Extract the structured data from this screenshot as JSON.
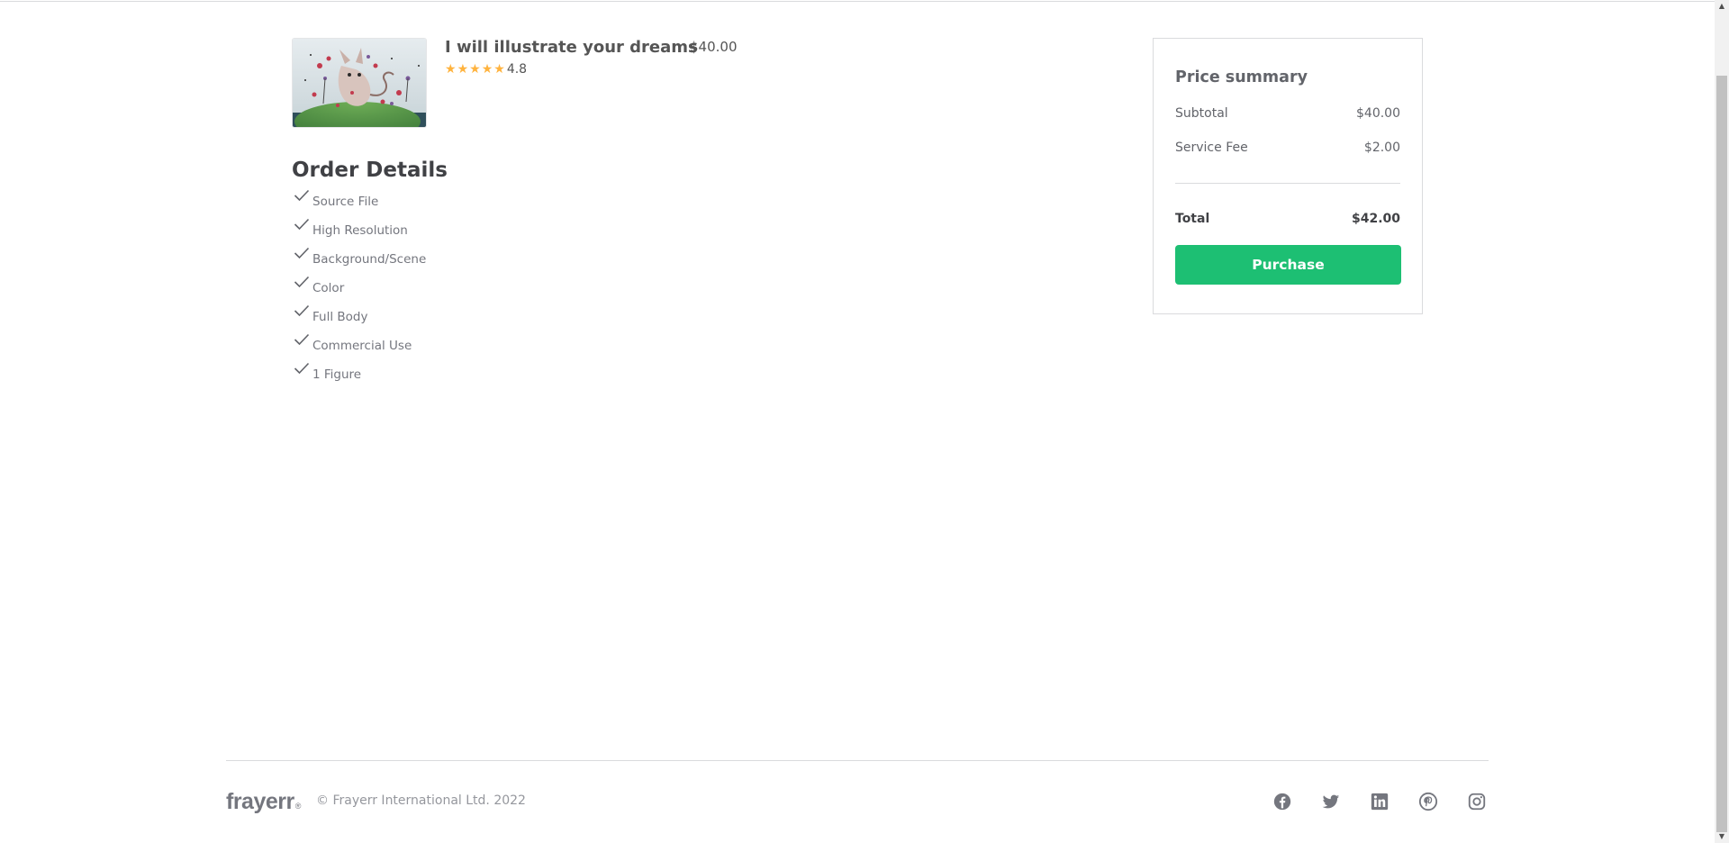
{
  "gig": {
    "image_alt": "Whimsical illustration of a cat in a fantasy garden",
    "title": "I will illustrate your dreams",
    "price": "$40.00",
    "rating": "4.8",
    "stars_filled": 5
  },
  "order_details": {
    "title": "Order Details",
    "features": [
      "Source File",
      "High Resolution",
      "Background/Scene",
      "Color",
      "Full Body",
      "Commercial Use",
      "1 Figure"
    ]
  },
  "summary": {
    "title": "Price summary",
    "subtotal_label": "Subtotal",
    "subtotal_value": "$40.00",
    "fee_label": "Service Fee",
    "fee_value": "$2.00",
    "total_label": "Total",
    "total_value": "$42.00",
    "purchase_label": "Purchase"
  },
  "footer": {
    "logo": "frayerr",
    "logo_mark": "®",
    "copyright": "© Frayerr International Ltd. 2022",
    "social_icons": [
      "facebook-icon",
      "twitter-icon",
      "linkedin-icon",
      "pinterest-icon",
      "instagram-icon"
    ]
  },
  "colors": {
    "accent": "#1dbf73",
    "star": "#ffb33e",
    "text_muted": "#74767e"
  }
}
